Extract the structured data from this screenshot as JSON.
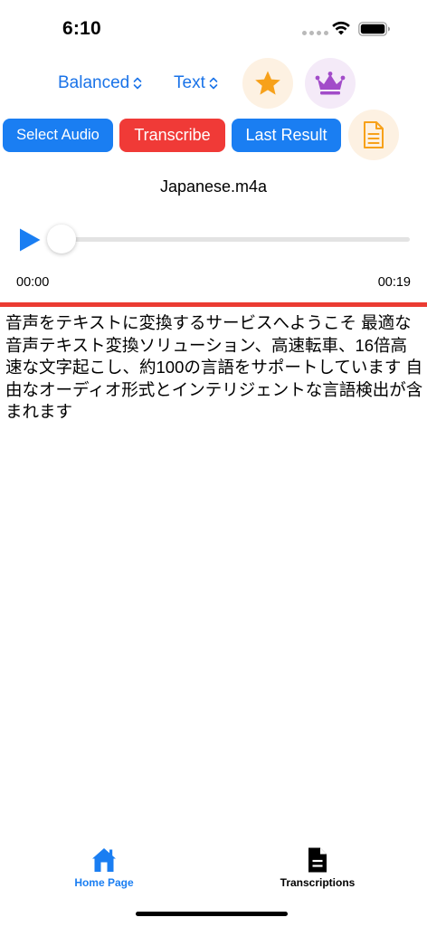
{
  "status": {
    "time": "6:10"
  },
  "controls": {
    "mode_picker": "Balanced",
    "format_picker": "Text",
    "star_icon": "star-icon",
    "crown_icon": "crown-icon",
    "doc_icon": "document-icon"
  },
  "actions": {
    "select_audio": "Select Audio",
    "transcribe": "Transcribe",
    "last_result": "Last Result"
  },
  "player": {
    "file_name": "Japanese.m4a",
    "current_time": "00:00",
    "total_time": "00:19",
    "progress": 0
  },
  "transcript": "音声をテキストに変換するサービスへようこそ 最適な音声テキスト変換ソリューション、高速転車、16倍高速な文字起こし、約100の言語をサポートしています 自由なオーディオ形式とインテリジェントな言語検出が含まれます",
  "tabs": [
    {
      "label": "Home Page",
      "icon": "home-icon",
      "active": true
    },
    {
      "label": "Transcriptions",
      "icon": "document-icon",
      "active": false
    }
  ],
  "colors": {
    "accent_blue": "#1a7ef2",
    "accent_red": "#f03a37",
    "star_orange": "#f7a11a",
    "crown_purple": "#a24cc9"
  }
}
